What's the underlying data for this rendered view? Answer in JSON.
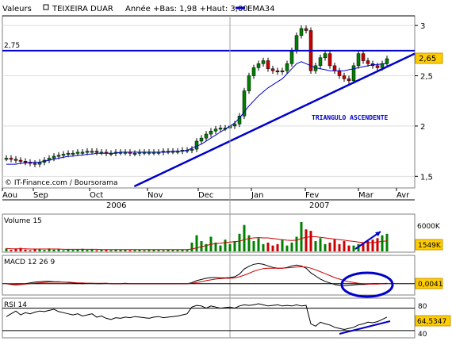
{
  "header": {
    "series_label": "Valeurs",
    "name": "TEIXEIRA DUAR",
    "stats": "Année +Bas: 1,98 +Haut: 3,00",
    "ema_label": "EMA34"
  },
  "colors": {
    "blue": "#0000cc",
    "up": "#008000",
    "down": "#cc0000",
    "ema": "#0000cc",
    "grid": "#dddddd",
    "tag_bg": "#ffcc00",
    "rsi_line": "#000000",
    "macd_signal": "#cc0000"
  },
  "annotations": {
    "resistance_level": "2,75",
    "pattern": "TRIANGULO  ASCENDENTE",
    "copyright": "© IT-Finance.com / Boursorama"
  },
  "chart_data": [
    {
      "type": "candlestick",
      "title": "TEIXEIRA DUAR",
      "months": [
        "Aou",
        "Sep",
        "Oct",
        "Nov",
        "Dec",
        "Jan",
        "Fev",
        "Mar",
        "Avr"
      ],
      "years": [
        "2006",
        "2007"
      ],
      "y_ticks": [
        "3",
        "2,5",
        "2",
        "1,5"
      ],
      "ylim": [
        1.4,
        3.08
      ],
      "last_value": "2,65",
      "close": [
        1.68,
        1.67,
        1.66,
        1.65,
        1.64,
        1.63,
        1.62,
        1.64,
        1.66,
        1.68,
        1.7,
        1.71,
        1.72,
        1.73,
        1.73,
        1.74,
        1.74,
        1.75,
        1.75,
        1.74,
        1.74,
        1.73,
        1.73,
        1.74,
        1.74,
        1.74,
        1.73,
        1.73,
        1.74,
        1.74,
        1.74,
        1.74,
        1.74,
        1.75,
        1.75,
        1.75,
        1.75,
        1.76,
        1.76,
        1.77,
        1.85,
        1.88,
        1.92,
        1.95,
        1.97,
        1.98,
        1.98,
        2.0,
        2.02,
        2.1,
        2.35,
        2.5,
        2.58,
        2.62,
        2.65,
        2.57,
        2.55,
        2.54,
        2.55,
        2.62,
        2.75,
        2.9,
        2.97,
        2.95,
        2.55,
        2.6,
        2.68,
        2.72,
        2.6,
        2.55,
        2.5,
        2.47,
        2.45,
        2.6,
        2.72,
        2.65,
        2.62,
        2.6,
        2.58,
        2.62,
        2.67
      ],
      "ema34": [
        1.62,
        1.62,
        1.62,
        1.63,
        1.63,
        1.64,
        1.64,
        1.64,
        1.65,
        1.66,
        1.67,
        1.68,
        1.69,
        1.7,
        1.7,
        1.71,
        1.71,
        1.72,
        1.72,
        1.73,
        1.73,
        1.73,
        1.73,
        1.73,
        1.74,
        1.74,
        1.74,
        1.74,
        1.74,
        1.74,
        1.74,
        1.74,
        1.74,
        1.74,
        1.74,
        1.75,
        1.75,
        1.75,
        1.76,
        1.78,
        1.8,
        1.82,
        1.85,
        1.88,
        1.91,
        1.94,
        1.97,
        2.0,
        2.03,
        2.08,
        2.14,
        2.2,
        2.25,
        2.3,
        2.34,
        2.38,
        2.41,
        2.44,
        2.47,
        2.52,
        2.57,
        2.62,
        2.64,
        2.62,
        2.6,
        2.58,
        2.57,
        2.56,
        2.55,
        2.55,
        2.55,
        2.55,
        2.56,
        2.57,
        2.58,
        2.59,
        2.6,
        2.61,
        2.61,
        2.62,
        2.62
      ],
      "trendline": [
        [
          0.32,
          1.4
        ],
        [
          1.0,
          2.72
        ]
      ],
      "resistance": 2.75
    },
    {
      "type": "bar",
      "title": "Volume 15",
      "y_ticks": [
        "6000K"
      ],
      "last_value": "1549K",
      "values": [
        0.1,
        0.05,
        0.08,
        0.12,
        0.06,
        0.04,
        0.09,
        0.07,
        0.05,
        0.1,
        0.06,
        0.08,
        0.04,
        0.07,
        0.05,
        0.06,
        0.09,
        0.05,
        0.07,
        0.04,
        0.06,
        0.05,
        0.04,
        0.07,
        0.05,
        0.06,
        0.04,
        0.05,
        0.06,
        0.04,
        0.05,
        0.06,
        0.05,
        0.04,
        0.06,
        0.05,
        0.05,
        0.06,
        0.05,
        0.3,
        0.55,
        0.35,
        0.25,
        0.5,
        0.3,
        0.2,
        0.4,
        0.25,
        0.35,
        0.6,
        0.9,
        0.55,
        0.35,
        0.45,
        0.25,
        0.3,
        0.2,
        0.25,
        0.4,
        0.2,
        0.3,
        0.5,
        1.0,
        0.75,
        0.7,
        0.35,
        0.45,
        0.25,
        0.3,
        0.4,
        0.25,
        0.35,
        0.2,
        0.2,
        0.25,
        0.3,
        0.35,
        0.4,
        0.45,
        0.55,
        0.6
      ],
      "avg_line": [
        0.1,
        0.09,
        0.09,
        0.09,
        0.09,
        0.08,
        0.08,
        0.08,
        0.08,
        0.08,
        0.08,
        0.08,
        0.07,
        0.07,
        0.07,
        0.07,
        0.07,
        0.07,
        0.07,
        0.07,
        0.06,
        0.06,
        0.06,
        0.06,
        0.06,
        0.06,
        0.06,
        0.06,
        0.06,
        0.06,
        0.06,
        0.06,
        0.06,
        0.06,
        0.06,
        0.06,
        0.06,
        0.06,
        0.06,
        0.08,
        0.12,
        0.16,
        0.2,
        0.24,
        0.27,
        0.28,
        0.3,
        0.32,
        0.33,
        0.35,
        0.4,
        0.44,
        0.46,
        0.47,
        0.46,
        0.46,
        0.44,
        0.42,
        0.4,
        0.38,
        0.37,
        0.38,
        0.44,
        0.48,
        0.5,
        0.5,
        0.48,
        0.46,
        0.44,
        0.42,
        0.4,
        0.38,
        0.36,
        0.34,
        0.32,
        0.3,
        0.3,
        0.3,
        0.32,
        0.34,
        0.36
      ]
    },
    {
      "type": "line",
      "title": "MACD 12 26 9",
      "last_value": "0,0041",
      "macd": [
        0.0,
        -0.02,
        -0.03,
        -0.02,
        0.0,
        0.02,
        0.04,
        0.05,
        0.06,
        0.06,
        0.05,
        0.05,
        0.04,
        0.03,
        0.02,
        0.01,
        0.0,
        0.01,
        0.01,
        0.0,
        0.0,
        0.01,
        0.0,
        0.0,
        0.0,
        0.01,
        0.0,
        0.0,
        0.0,
        0.0,
        0.0,
        0.0,
        0.0,
        0.0,
        0.0,
        0.0,
        0.0,
        0.0,
        0.0,
        0.03,
        0.08,
        0.11,
        0.14,
        0.16,
        0.16,
        0.15,
        0.15,
        0.16,
        0.18,
        0.25,
        0.38,
        0.45,
        0.5,
        0.52,
        0.5,
        0.46,
        0.42,
        0.4,
        0.4,
        0.42,
        0.46,
        0.48,
        0.46,
        0.4,
        0.28,
        0.2,
        0.12,
        0.06,
        0.02,
        -0.02,
        -0.04,
        -0.05,
        -0.04,
        -0.03,
        -0.02,
        -0.02,
        -0.01,
        0.0,
        0.0,
        0.0,
        0.01
      ],
      "signal": [
        0.0,
        -0.01,
        -0.01,
        -0.02,
        -0.01,
        0.0,
        0.01,
        0.02,
        0.03,
        0.04,
        0.04,
        0.04,
        0.04,
        0.04,
        0.03,
        0.02,
        0.02,
        0.01,
        0.01,
        0.01,
        0.01,
        0.01,
        0.0,
        0.0,
        0.0,
        0.0,
        0.0,
        0.0,
        0.0,
        0.0,
        0.0,
        0.0,
        0.0,
        0.0,
        0.0,
        0.0,
        0.0,
        0.0,
        0.0,
        0.01,
        0.03,
        0.05,
        0.08,
        0.1,
        0.12,
        0.13,
        0.14,
        0.14,
        0.15,
        0.18,
        0.22,
        0.27,
        0.32,
        0.36,
        0.39,
        0.4,
        0.4,
        0.4,
        0.4,
        0.41,
        0.42,
        0.43,
        0.44,
        0.43,
        0.4,
        0.36,
        0.31,
        0.26,
        0.21,
        0.16,
        0.12,
        0.08,
        0.05,
        0.03,
        0.01,
        0.0,
        -0.01,
        -0.01,
        -0.01,
        0.0,
        0.0
      ],
      "ylim": [
        -0.25,
        0.65
      ]
    },
    {
      "type": "line",
      "title": "RSI 14",
      "y_ticks": [
        "80",
        "40"
      ],
      "last_value": "64,5347",
      "values": [
        65,
        70,
        75,
        68,
        72,
        70,
        73,
        75,
        74,
        76,
        78,
        74,
        72,
        70,
        68,
        70,
        66,
        68,
        70,
        64,
        66,
        62,
        60,
        63,
        62,
        64,
        63,
        65,
        64,
        63,
        62,
        64,
        65,
        63,
        64,
        65,
        66,
        68,
        70,
        82,
        85,
        84,
        80,
        84,
        82,
        80,
        81,
        82,
        80,
        84,
        86,
        85,
        86,
        88,
        86,
        84,
        85,
        86,
        84,
        85,
        84,
        86,
        84,
        85,
        52,
        48,
        55,
        52,
        50,
        46,
        44,
        42,
        44,
        46,
        50,
        52,
        55,
        54,
        56,
        60,
        64
      ],
      "ylim": [
        30,
        95
      ]
    }
  ]
}
